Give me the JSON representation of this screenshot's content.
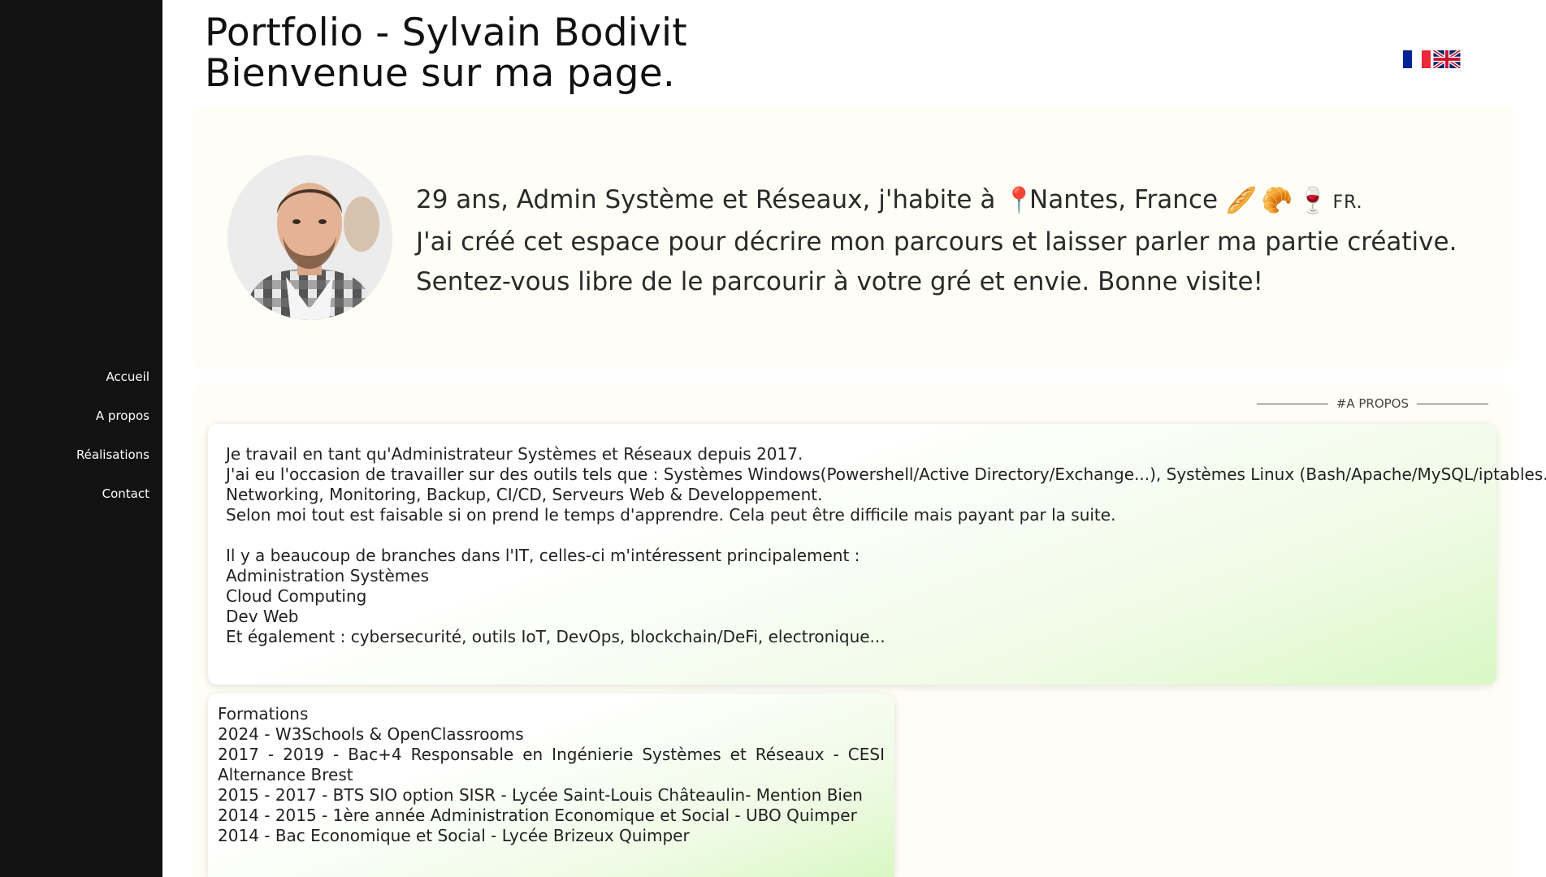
{
  "header": {
    "title": "Portfolio - Sylvain Bodivit",
    "subtitle": "Bienvenue sur ma page."
  },
  "sidebar": {
    "items": [
      {
        "label": "Accueil"
      },
      {
        "label": "A propos"
      },
      {
        "label": "Réalisations"
      },
      {
        "label": "Contact"
      }
    ]
  },
  "languages": [
    "fr-flag-icon",
    "uk-flag-icon"
  ],
  "hero": {
    "line1_before": "29 ans, Admin Système et Réseaux, j'habite à ",
    "pin_icon": "📍",
    "line1_location": " Nantes, France ",
    "emoji_1": "🥖",
    "emoji_2": "🥐",
    "emoji_3": "🍷",
    "line1_flag": "FR.",
    "line2": "J'ai créé cet espace pour décrire mon parcours et laisser parler ma partie créative.",
    "line3": "Sentez-vous libre de le parcourir à votre gré et envie. Bonne visite!"
  },
  "about": {
    "section_label": "#A PROPOS",
    "lines": [
      "Je travail en tant qu'Administrateur Systèmes et Réseaux depuis 2017.",
      "J'ai eu l'occasion de travailler sur des outils tels que : Systèmes Windows(Powershell/Active Directory/Exchange...), Systèmes Linux (Bash/Apache/MySQL/iptables...),",
      "Networking, Monitoring, Backup, CI/CD, Serveurs Web & Developpement.",
      "Selon moi tout est faisable si on prend le temps d'apprendre. Cela peut être difficile mais payant par la suite."
    ],
    "interests_intro": "Il y a beaucoup de branches dans l'IT, celles-ci m'intéressent principalement :",
    "interests": [
      "Administration Systèmes",
      "Cloud Computing",
      "Dev Web"
    ],
    "also": "Et également : cybersecurité, outils IoT, DevOps, blockchain/DeFi, electronique..."
  },
  "formations": {
    "heading": "Formations",
    "items": [
      "2024 - W3Schools & OpenClassrooms",
      "2017 - 2019 - Bac+4 Responsable en Ingénierie Systèmes et Réseaux - CESI Alternance Brest",
      "2015 - 2017 - BTS SIO option SISR - Lycée Saint-Louis Châteaulin- Mention Bien",
      "2014 - 2015 - 1ère année Administration Economique et Social - UBO Quimper",
      "2014 - Bac Economique et Social - Lycée Brizeux Quimper"
    ]
  },
  "colors": {
    "sidebar_bg": "#121212",
    "section_bg": "#fefef6",
    "card_gradient_end": "#d9f7c4"
  }
}
